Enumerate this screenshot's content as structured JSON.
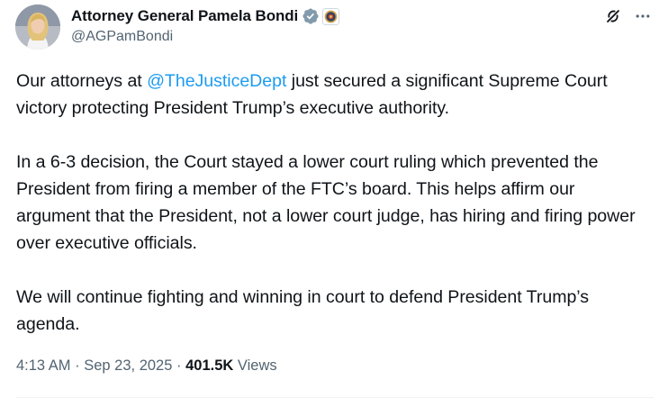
{
  "author": {
    "display_name": "Attorney General Pamela Bondi",
    "handle": "@AGPamBondi"
  },
  "post": {
    "p1_prefix": "Our attorneys at ",
    "p1_mention": "@TheJusticeDept",
    "p1_suffix": " just secured a significant Supreme Court victory protecting President Trump’s executive authority.",
    "p2": "In a 6-3 decision, the Court stayed a lower court ruling which prevented the President from firing a member of the FTC’s board. This helps affirm our argument that the President, not a lower court judge, has hiring and firing power over executive officials.",
    "p3": "We will continue fighting and winning in court to defend President Trump’s agenda."
  },
  "meta": {
    "time": "4:13 AM",
    "sep": "·",
    "date": "Sep 23, 2025",
    "views_count": "401.5K",
    "views_label": "Views"
  },
  "icons": {
    "verified": "verified-badge-icon",
    "affiliate": "affiliate-seal-icon",
    "grok": "grok-icon",
    "more": "more-icon"
  },
  "colors": {
    "text": "#0f1419",
    "secondary": "#536471",
    "link": "#1d9bf0",
    "verified_gray": "#829aab"
  }
}
